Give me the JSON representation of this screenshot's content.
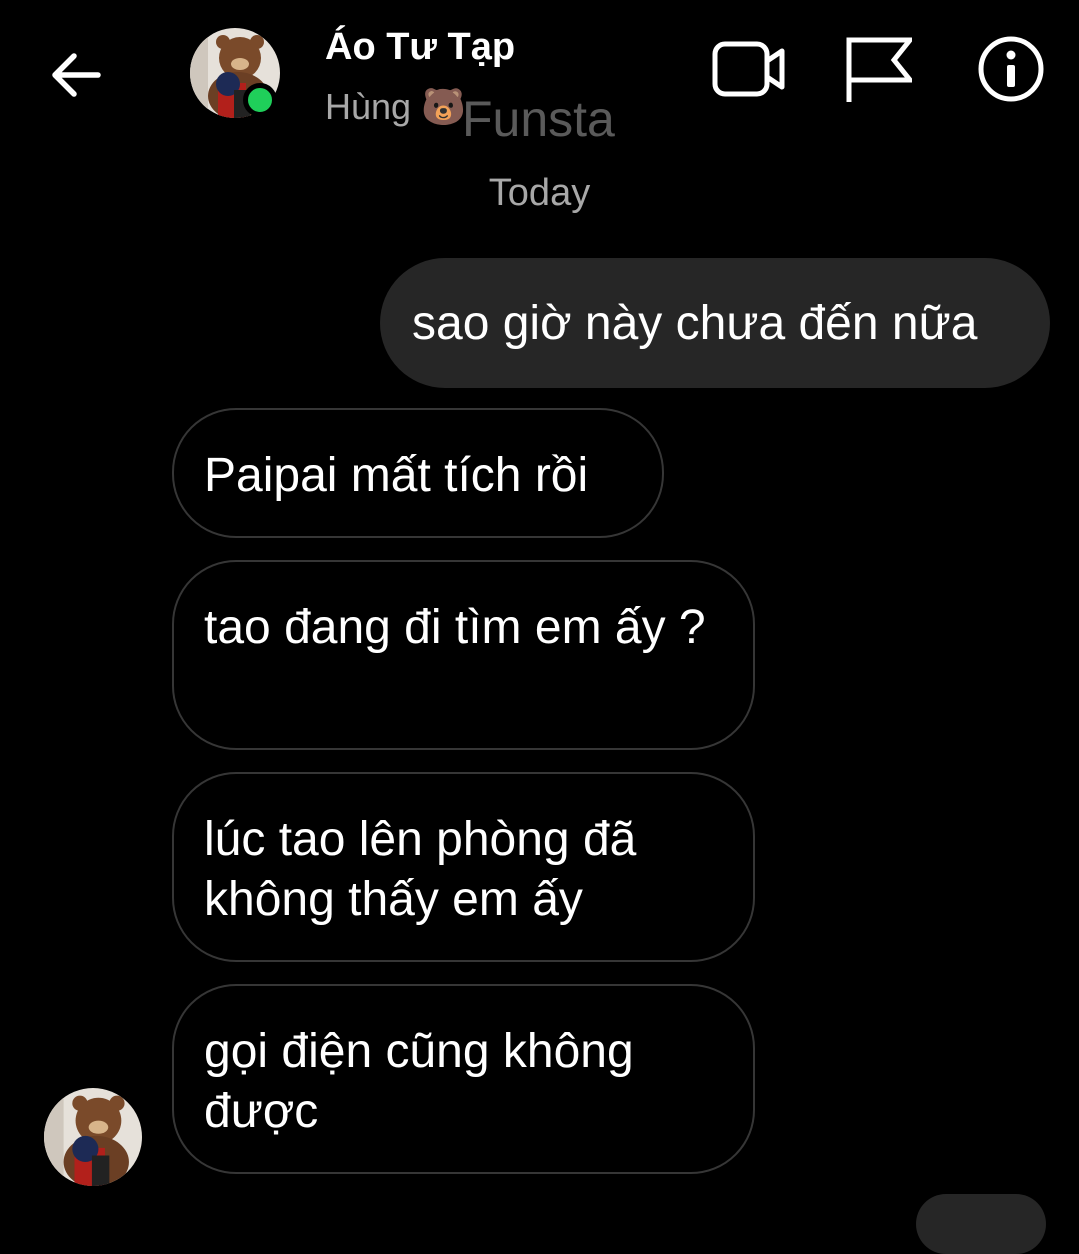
{
  "header": {
    "title": "Áo Tư Tạp",
    "subtitle": "Hùng 🐻",
    "watermark": "Funsta",
    "online": true
  },
  "icons": {
    "back": "arrow-left-icon",
    "video": "video-camera-icon",
    "flag": "flag-icon",
    "info": "info-icon"
  },
  "conversation": {
    "date_label": "Today",
    "messages": [
      {
        "direction": "outgoing",
        "text": "sao giờ này chưa đến nữa"
      },
      {
        "direction": "incoming",
        "text": "Paipai mất tích rồi"
      },
      {
        "direction": "incoming",
        "text": "tao đang đi tìm em ấy ?"
      },
      {
        "direction": "incoming",
        "text": "lúc tao lên phòng đã không thấy em ấy"
      },
      {
        "direction": "incoming",
        "text": "gọi điện cũng không được"
      }
    ]
  },
  "colors": {
    "background": "#000000",
    "outgoing_bubble": "#262626",
    "incoming_border": "#363636",
    "online_dot": "#1fcf5a",
    "secondary_text": "#a8a8a8"
  }
}
